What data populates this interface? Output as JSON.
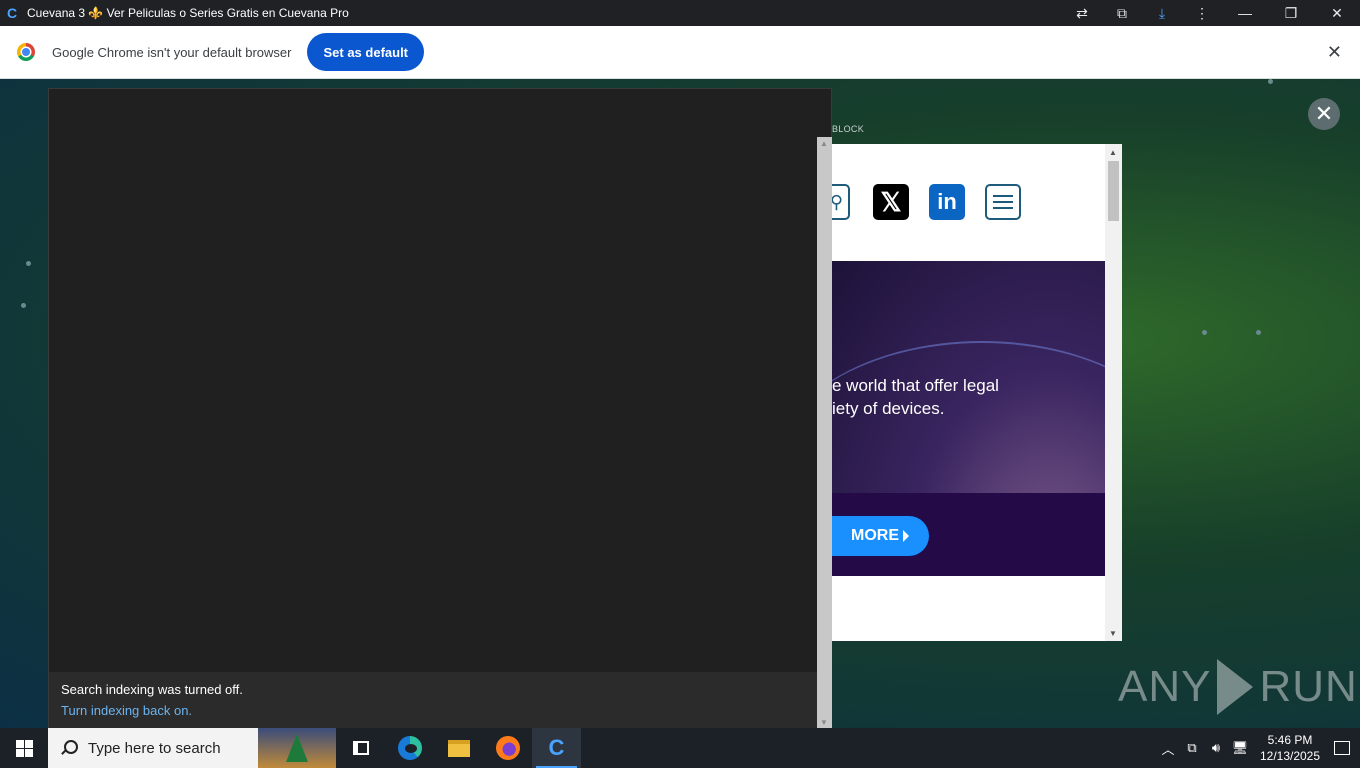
{
  "window": {
    "title": "Cuevana 3 ⚜️ Ver Peliculas o Series Gratis en Cuevana Pro",
    "minimize_glyph": "—",
    "restore_glyph": "❐",
    "close_glyph": "✕"
  },
  "infobar": {
    "message": "Google Chrome isn't your default browser",
    "button_label": "Set as default",
    "close_glyph": "✕"
  },
  "page": {
    "adblock_label": "BLOCK",
    "close_glyph": "✕"
  },
  "ad": {
    "x_glyph": "𝕏",
    "linkedin_glyph": "in",
    "hero_line1": "e world that offer legal",
    "hero_line2": "iety of devices.",
    "more_label": "MORE"
  },
  "watermark": {
    "left": "ANY",
    "right": "RUN"
  },
  "search_panel": {
    "notice": "Search indexing was turned off.",
    "link": "Turn indexing back on."
  },
  "taskbar": {
    "search_placeholder": "Type here to search",
    "time": "5:46 PM",
    "date": "12/13/2025"
  },
  "colors": {
    "accent": "#0b57d0",
    "more_button": "#1a90ff",
    "link": "#6cb4f0"
  }
}
